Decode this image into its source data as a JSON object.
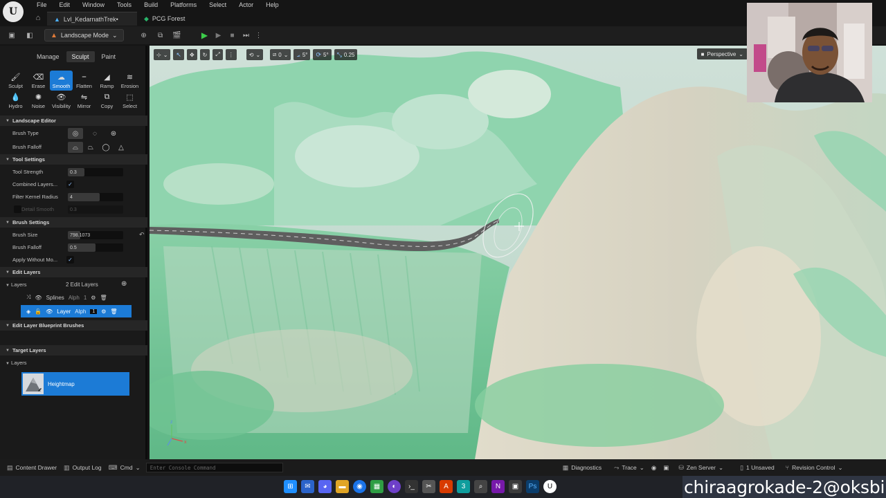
{
  "app": {
    "logo_letter": "U",
    "menu": [
      "File",
      "Edit",
      "Window",
      "Tools",
      "Build",
      "Platforms",
      "Select",
      "Actor",
      "Help"
    ]
  },
  "tabs": [
    {
      "label": "Lvl_KedarnathTrek•",
      "active": true
    },
    {
      "label": "PCG Forest",
      "active": false
    }
  ],
  "toolbar": {
    "mode_label": "Landscape Mode"
  },
  "left_panel": {
    "mode_tabs": [
      "Manage",
      "Sculpt",
      "Paint"
    ],
    "active_mode": "Sculpt",
    "tools": [
      {
        "label": "Sculpt",
        "icon": "brush-icon"
      },
      {
        "label": "Erase",
        "icon": "eraser-icon"
      },
      {
        "label": "Smooth",
        "icon": "smooth-icon",
        "active": true
      },
      {
        "label": "Flatten",
        "icon": "flatten-icon"
      },
      {
        "label": "Ramp",
        "icon": "ramp-icon"
      },
      {
        "label": "Erosion",
        "icon": "erosion-icon"
      },
      {
        "label": "Hydro",
        "icon": "hydro-icon"
      },
      {
        "label": "Noise",
        "icon": "noise-icon"
      },
      {
        "label": "Visibility",
        "icon": "visibility-icon"
      },
      {
        "label": "Mirror",
        "icon": "mirror-icon"
      },
      {
        "label": "Copy",
        "icon": "copy-icon"
      },
      {
        "label": "Select",
        "icon": "select-icon"
      }
    ],
    "sections": {
      "landscape_editor": "Landscape Editor",
      "tool_settings": "Tool Settings",
      "brush_settings": "Brush Settings",
      "edit_layers": "Edit Layers",
      "edit_layer_bp": "Edit Layer Blueprint Brushes",
      "target_layers": "Target Layers"
    },
    "props": {
      "brush_type": "Brush Type",
      "brush_falloff": "Brush Falloff",
      "tool_strength": {
        "label": "Tool Strength",
        "value": "0.3",
        "fraction": 0.3
      },
      "combined_layers": {
        "label": "Combined Layers...",
        "checked": true
      },
      "filter_kernel": {
        "label": "Filter Kernel Radius",
        "value": "4"
      },
      "detail_smooth": {
        "label": "Detail Smooth",
        "value": "0.3"
      },
      "brush_size": {
        "label": "Brush Size",
        "value": "798.1073"
      },
      "brush_falloff2": {
        "label": "Brush Falloff",
        "value": "0.5",
        "fraction": 0.5
      },
      "apply_without": {
        "label": "Apply Without Mo...",
        "checked": true
      }
    },
    "layers": {
      "label": "Layers",
      "count": "2 Edit Layers",
      "items": [
        {
          "name": "Splines",
          "alpha": "Alph",
          "value": "1",
          "selected": false
        },
        {
          "name": "Layer",
          "alpha": "Alph",
          "value": "1",
          "selected": true
        }
      ]
    },
    "target_layers": {
      "label": "Layers",
      "heightmap": "Heightmap"
    }
  },
  "viewport": {
    "snap_move": "0",
    "snap_rot": "5°",
    "snap_scale": "5°",
    "cam_speed": "0.25",
    "view_mode": "Perspective",
    "view_num": "6"
  },
  "statusbar": {
    "content_drawer": "Content Drawer",
    "output_log": "Output Log",
    "cmd": "Cmd",
    "console_placeholder": "Enter Console Command",
    "diagnostics": "Diagnostics",
    "trace": "Trace",
    "zen": "Zen Server",
    "unsaved": "1 Unsaved",
    "revision": "Revision Control"
  },
  "watermark": "chiraagrokade-2@oksbi",
  "colors": {
    "accent": "#1c7bd6",
    "terrain_green": "#7fcfa0",
    "terrain_sand": "#d9d2bd",
    "road": "#5e5e5e"
  }
}
